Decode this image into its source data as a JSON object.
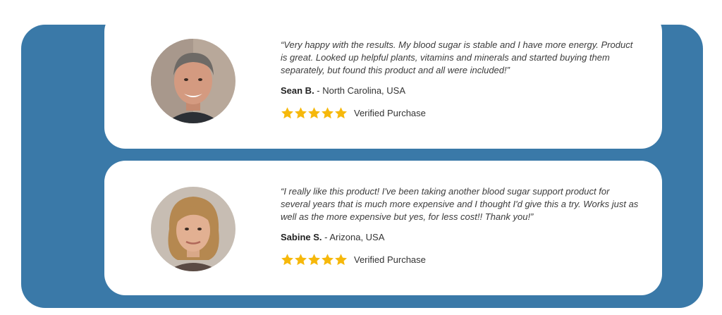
{
  "colors": {
    "panel": "#3a79a8",
    "card": "#ffffff",
    "star": "#f6b80b"
  },
  "reviews": [
    {
      "quote": "“Very happy with the results. My blood sugar is stable and I have more energy. Product is great. Looked up helpful plants, vitamins and minerals and started buying them separately, but found this product and all were included!”",
      "name": "Sean B.",
      "location": " - North Carolina, USA",
      "rating": 5,
      "verified_label": "Verified Purchase"
    },
    {
      "quote": "“I really like this product! I've been taking another blood sugar support product for several years that is much more expensive and I thought I'd give this a try. Works just as well as the more expensive but yes, for less cost!! Thank you!”",
      "name": "Sabine S.",
      "location": " - Arizona, USA",
      "rating": 5,
      "verified_label": "Verified Purchase"
    }
  ]
}
